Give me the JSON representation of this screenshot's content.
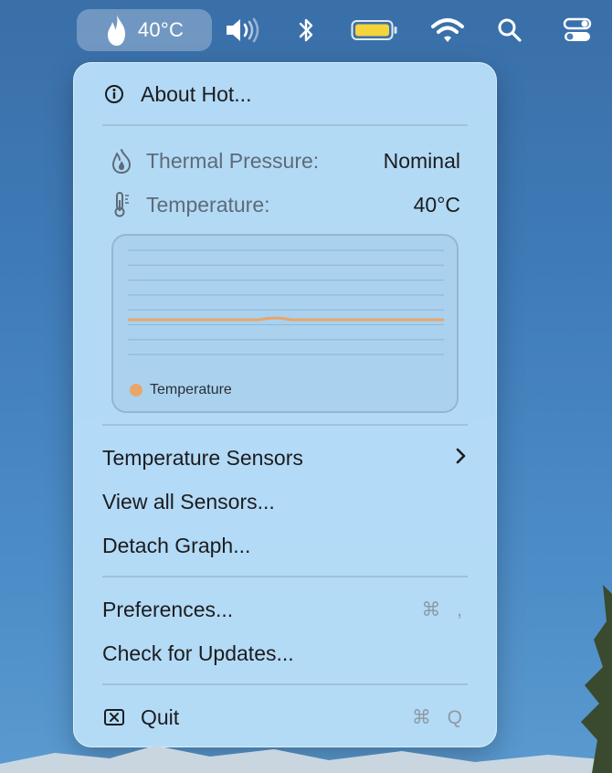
{
  "menubar": {
    "hot_temperature": "40°C",
    "icons": [
      "flame-icon",
      "volume-icon",
      "bluetooth-icon",
      "battery-icon",
      "wifi-icon",
      "search-icon",
      "control-center-icon"
    ]
  },
  "menu": {
    "about": "About Hot...",
    "thermal_pressure_label": "Thermal Pressure:",
    "thermal_pressure_value": "Nominal",
    "temperature_label": "Temperature:",
    "temperature_value": "40°C",
    "temperature_sensors": "Temperature Sensors",
    "view_all_sensors": "View all Sensors...",
    "detach_graph": "Detach Graph...",
    "preferences": "Preferences...",
    "preferences_shortcut": "⌘ ,",
    "check_updates": "Check for Updates...",
    "quit": "Quit",
    "quit_shortcut": "⌘ Q"
  },
  "chart_data": {
    "type": "line",
    "series": [
      {
        "name": "Temperature",
        "values": [
          40,
          40,
          40,
          40,
          40,
          40,
          40,
          40,
          40,
          40,
          40,
          40,
          40,
          41,
          41,
          40,
          40,
          40,
          40,
          40,
          40,
          40,
          40,
          40,
          40,
          40,
          40,
          40,
          40,
          40
        ]
      }
    ],
    "ylim": [
      20,
      80
    ],
    "grid": true,
    "legend": "bottom-left",
    "colors": {
      "Temperature": "#e9a56a"
    }
  }
}
